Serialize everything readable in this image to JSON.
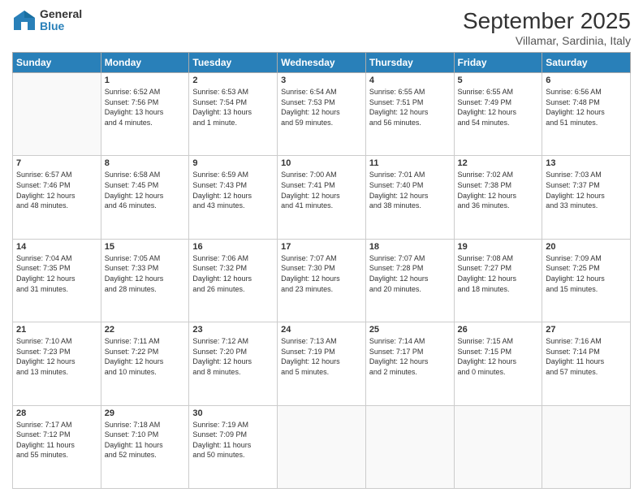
{
  "logo": {
    "general": "General",
    "blue": "Blue"
  },
  "header": {
    "month": "September 2025",
    "location": "Villamar, Sardinia, Italy"
  },
  "weekdays": [
    "Sunday",
    "Monday",
    "Tuesday",
    "Wednesday",
    "Thursday",
    "Friday",
    "Saturday"
  ],
  "weeks": [
    [
      {
        "day": "",
        "info": ""
      },
      {
        "day": "1",
        "info": "Sunrise: 6:52 AM\nSunset: 7:56 PM\nDaylight: 13 hours\nand 4 minutes."
      },
      {
        "day": "2",
        "info": "Sunrise: 6:53 AM\nSunset: 7:54 PM\nDaylight: 13 hours\nand 1 minute."
      },
      {
        "day": "3",
        "info": "Sunrise: 6:54 AM\nSunset: 7:53 PM\nDaylight: 12 hours\nand 59 minutes."
      },
      {
        "day": "4",
        "info": "Sunrise: 6:55 AM\nSunset: 7:51 PM\nDaylight: 12 hours\nand 56 minutes."
      },
      {
        "day": "5",
        "info": "Sunrise: 6:55 AM\nSunset: 7:49 PM\nDaylight: 12 hours\nand 54 minutes."
      },
      {
        "day": "6",
        "info": "Sunrise: 6:56 AM\nSunset: 7:48 PM\nDaylight: 12 hours\nand 51 minutes."
      }
    ],
    [
      {
        "day": "7",
        "info": "Sunrise: 6:57 AM\nSunset: 7:46 PM\nDaylight: 12 hours\nand 48 minutes."
      },
      {
        "day": "8",
        "info": "Sunrise: 6:58 AM\nSunset: 7:45 PM\nDaylight: 12 hours\nand 46 minutes."
      },
      {
        "day": "9",
        "info": "Sunrise: 6:59 AM\nSunset: 7:43 PM\nDaylight: 12 hours\nand 43 minutes."
      },
      {
        "day": "10",
        "info": "Sunrise: 7:00 AM\nSunset: 7:41 PM\nDaylight: 12 hours\nand 41 minutes."
      },
      {
        "day": "11",
        "info": "Sunrise: 7:01 AM\nSunset: 7:40 PM\nDaylight: 12 hours\nand 38 minutes."
      },
      {
        "day": "12",
        "info": "Sunrise: 7:02 AM\nSunset: 7:38 PM\nDaylight: 12 hours\nand 36 minutes."
      },
      {
        "day": "13",
        "info": "Sunrise: 7:03 AM\nSunset: 7:37 PM\nDaylight: 12 hours\nand 33 minutes."
      }
    ],
    [
      {
        "day": "14",
        "info": "Sunrise: 7:04 AM\nSunset: 7:35 PM\nDaylight: 12 hours\nand 31 minutes."
      },
      {
        "day": "15",
        "info": "Sunrise: 7:05 AM\nSunset: 7:33 PM\nDaylight: 12 hours\nand 28 minutes."
      },
      {
        "day": "16",
        "info": "Sunrise: 7:06 AM\nSunset: 7:32 PM\nDaylight: 12 hours\nand 26 minutes."
      },
      {
        "day": "17",
        "info": "Sunrise: 7:07 AM\nSunset: 7:30 PM\nDaylight: 12 hours\nand 23 minutes."
      },
      {
        "day": "18",
        "info": "Sunrise: 7:07 AM\nSunset: 7:28 PM\nDaylight: 12 hours\nand 20 minutes."
      },
      {
        "day": "19",
        "info": "Sunrise: 7:08 AM\nSunset: 7:27 PM\nDaylight: 12 hours\nand 18 minutes."
      },
      {
        "day": "20",
        "info": "Sunrise: 7:09 AM\nSunset: 7:25 PM\nDaylight: 12 hours\nand 15 minutes."
      }
    ],
    [
      {
        "day": "21",
        "info": "Sunrise: 7:10 AM\nSunset: 7:23 PM\nDaylight: 12 hours\nand 13 minutes."
      },
      {
        "day": "22",
        "info": "Sunrise: 7:11 AM\nSunset: 7:22 PM\nDaylight: 12 hours\nand 10 minutes."
      },
      {
        "day": "23",
        "info": "Sunrise: 7:12 AM\nSunset: 7:20 PM\nDaylight: 12 hours\nand 8 minutes."
      },
      {
        "day": "24",
        "info": "Sunrise: 7:13 AM\nSunset: 7:19 PM\nDaylight: 12 hours\nand 5 minutes."
      },
      {
        "day": "25",
        "info": "Sunrise: 7:14 AM\nSunset: 7:17 PM\nDaylight: 12 hours\nand 2 minutes."
      },
      {
        "day": "26",
        "info": "Sunrise: 7:15 AM\nSunset: 7:15 PM\nDaylight: 12 hours\nand 0 minutes."
      },
      {
        "day": "27",
        "info": "Sunrise: 7:16 AM\nSunset: 7:14 PM\nDaylight: 11 hours\nand 57 minutes."
      }
    ],
    [
      {
        "day": "28",
        "info": "Sunrise: 7:17 AM\nSunset: 7:12 PM\nDaylight: 11 hours\nand 55 minutes."
      },
      {
        "day": "29",
        "info": "Sunrise: 7:18 AM\nSunset: 7:10 PM\nDaylight: 11 hours\nand 52 minutes."
      },
      {
        "day": "30",
        "info": "Sunrise: 7:19 AM\nSunset: 7:09 PM\nDaylight: 11 hours\nand 50 minutes."
      },
      {
        "day": "",
        "info": ""
      },
      {
        "day": "",
        "info": ""
      },
      {
        "day": "",
        "info": ""
      },
      {
        "day": "",
        "info": ""
      }
    ]
  ]
}
